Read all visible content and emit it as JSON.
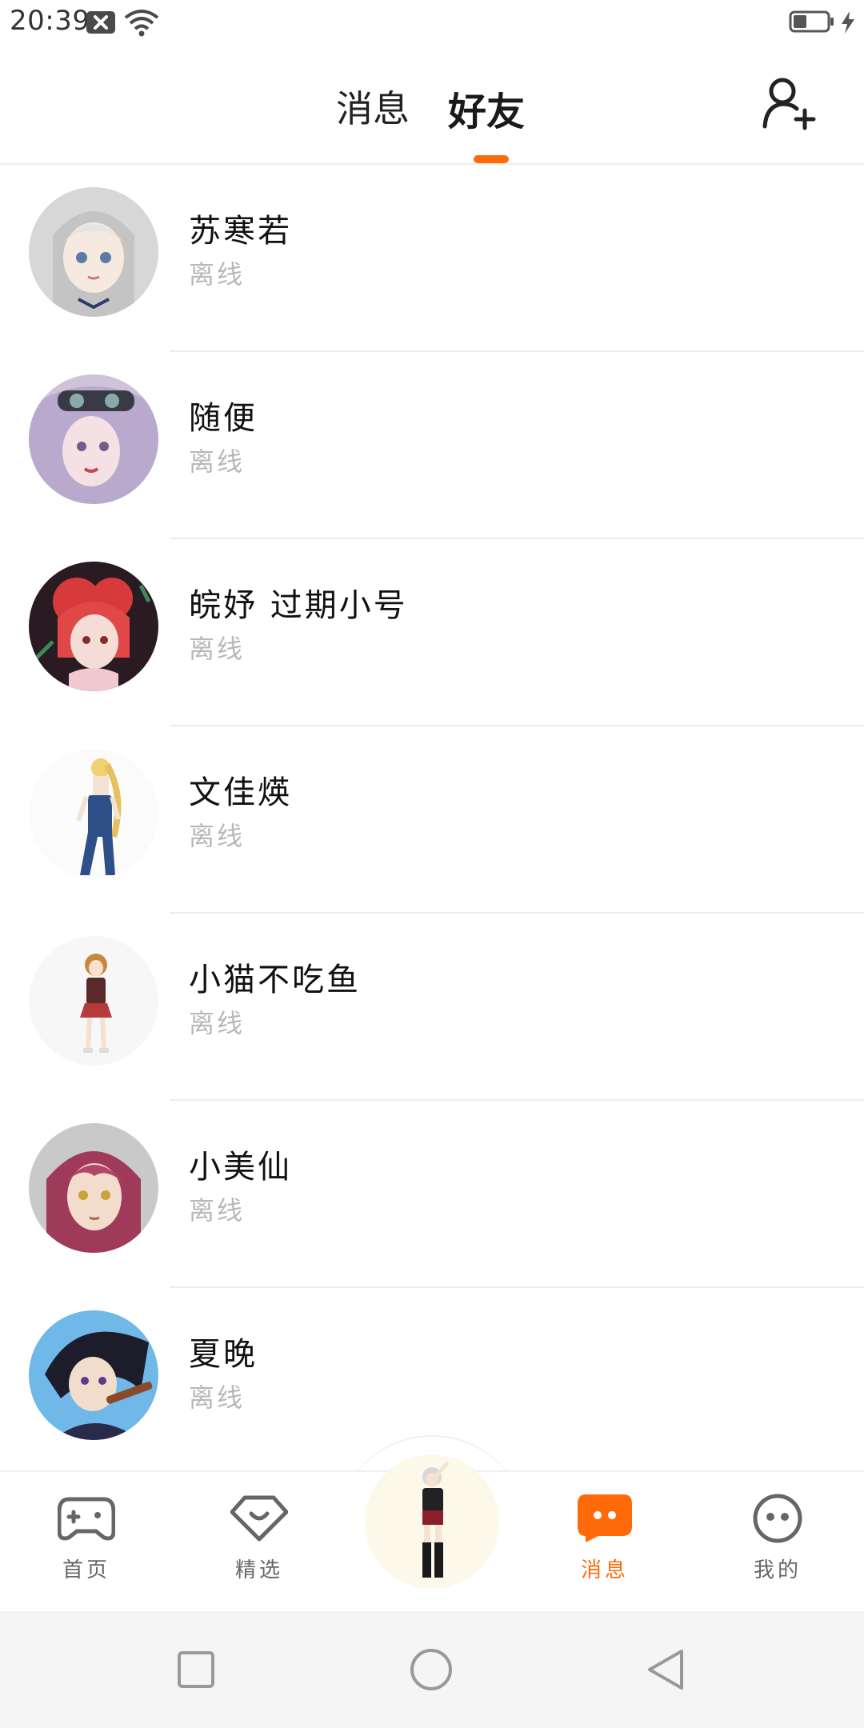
{
  "status_bar": {
    "time": "20:39",
    "icons": [
      "notification-x-icon",
      "wifi-icon",
      "battery-icon",
      "charging-bolt-icon"
    ]
  },
  "header": {
    "tabs": [
      {
        "label": "消息",
        "active": false
      },
      {
        "label": "好友",
        "active": true
      }
    ],
    "accent_color": "#ff6a0a",
    "add_friend_icon": "add-user-icon"
  },
  "friends": [
    {
      "name": "苏寒若",
      "status": "离线"
    },
    {
      "name": "随便",
      "status": "离线"
    },
    {
      "name": "皖妤 过期小号",
      "status": "离线"
    },
    {
      "name": "文佳煐",
      "status": "离线"
    },
    {
      "name": "小猫不吃鱼",
      "status": "离线"
    },
    {
      "name": "小美仙",
      "status": "离线"
    },
    {
      "name": "夏晚",
      "status": "离线"
    }
  ],
  "bottom_nav": {
    "items": [
      {
        "label": "首页",
        "icon": "gamepad-icon",
        "active": false
      },
      {
        "label": "精选",
        "icon": "heart-diamond-icon",
        "active": false
      },
      {
        "label": "",
        "icon": "character-avatar",
        "active": false
      },
      {
        "label": "消息",
        "icon": "chat-bubble-icon",
        "active": true
      },
      {
        "label": "我的",
        "icon": "face-icon",
        "active": false
      }
    ]
  },
  "system_nav": {
    "buttons": [
      "recent-apps-icon",
      "home-icon",
      "back-icon"
    ]
  }
}
